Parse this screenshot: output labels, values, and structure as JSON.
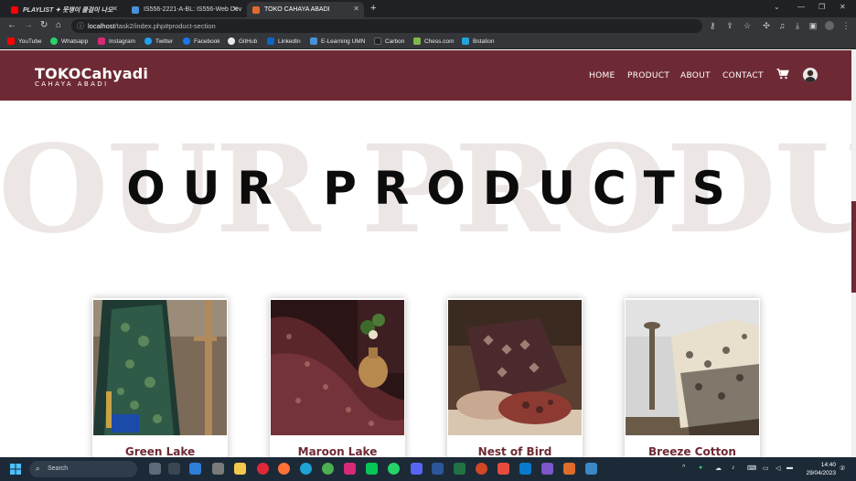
{
  "browser": {
    "tabs": [
      {
        "title": "PLAYLIST ✦ 뭇쟁이 쿨걸이 나오",
        "favicon_color": "#ff0000",
        "active": false
      },
      {
        "title": "IS556-2221-A-BL: IS556-Web Dev",
        "favicon_color": "#4a90d9",
        "active": false
      },
      {
        "title": "TOKO CAHAYA ABADI",
        "favicon_color": "#e06c2c",
        "active": true
      }
    ],
    "new_tab_icon": "+",
    "url_host": "localhost",
    "url_path": "/task2/index.php#product-section",
    "bookmarks": [
      {
        "label": "YouTube",
        "color": "#ff0000"
      },
      {
        "label": "Whatsapp",
        "color": "#25d366"
      },
      {
        "label": "Instagram",
        "color": "#d62976"
      },
      {
        "label": "Twitter",
        "color": "#1da1f2"
      },
      {
        "label": "Facebook",
        "color": "#1877f2"
      },
      {
        "label": "GitHub",
        "color": "#e8eaed"
      },
      {
        "label": "LinkedIn",
        "color": "#0a66c2"
      },
      {
        "label": "E-Learning UMN",
        "color": "#4a90d9"
      },
      {
        "label": "Carbon",
        "color": "#222222"
      },
      {
        "label": "Chess.com",
        "color": "#81b64c"
      },
      {
        "label": "Bstation",
        "color": "#23a3dc"
      }
    ]
  },
  "site": {
    "brand_color": "#6e2a34",
    "logo_main": "TOKOCahyadi",
    "logo_sub": "CAHAYA ABADI",
    "nav": [
      "HOME",
      "PRODUCT",
      "ABOUT",
      "CONTACT"
    ],
    "cart_icon": "cart-icon",
    "avatar_icon": "user-avatar"
  },
  "products_section": {
    "background_word": "OUR PRODUCTS",
    "heading": "OUR PRODUCTS",
    "items": [
      {
        "name": "Green Lake"
      },
      {
        "name": "Maroon Lake"
      },
      {
        "name": "Nest of Bird"
      },
      {
        "name": "Breeze Cotton"
      }
    ]
  },
  "taskbar": {
    "search_placeholder": "Search",
    "time": "14:40",
    "date": "29/04/2023"
  }
}
